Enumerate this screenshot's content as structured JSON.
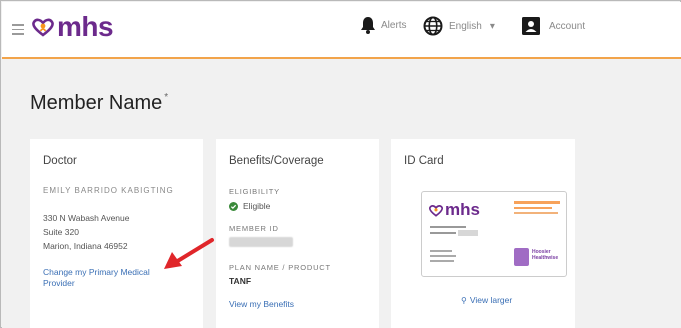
{
  "colors": {
    "brand_purple": "#6c2a8c",
    "brand_orange": "#f7941d",
    "accent_line": "#f2a44b",
    "link": "#3a6fb5",
    "eligible_green": "#3a8a3a",
    "arrow_red": "#e0262a"
  },
  "header": {
    "logo_text": "mhs",
    "alerts_label": "Alerts",
    "language_label": "English",
    "account_label": "Account"
  },
  "page": {
    "title": "Member Name",
    "title_marker": "*"
  },
  "doctor_card": {
    "title": "Doctor",
    "doctor_name": "EMILY BARRIDO KABIGTING",
    "address_line1": "330 N Wabash Avenue",
    "address_line2": "Suite 320",
    "address_line3": "Marion, Indiana 46952",
    "change_link": "Change my Primary Medical Provider"
  },
  "benefits_card": {
    "title": "Benefits/Coverage",
    "eligibility_label": "ELIGIBILITY",
    "eligibility_value": "Eligible",
    "member_id_label": "MEMBER ID",
    "plan_label": "PLAN NAME / PRODUCT",
    "plan_value": "TANF",
    "view_link": "View my Benefits"
  },
  "id_card": {
    "title": "ID Card",
    "card_logo_text": "mhs",
    "card_program_line1": "Hoosier",
    "card_program_line2": "Healthwise",
    "view_larger_link": "View larger"
  }
}
